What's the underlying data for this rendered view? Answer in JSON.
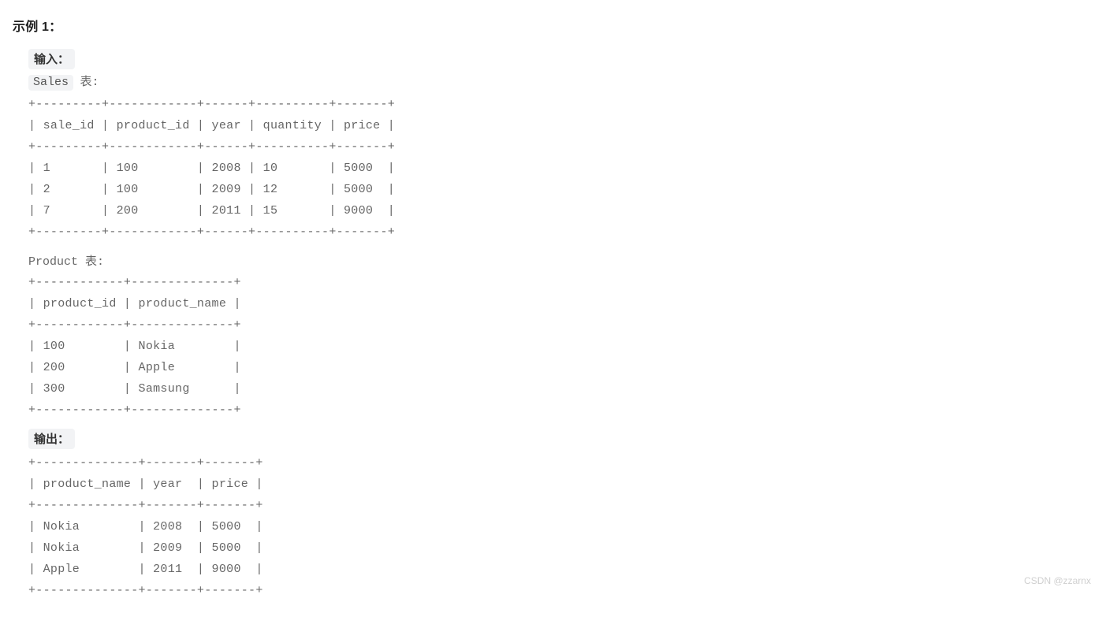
{
  "heading": "示例 1：",
  "input_label": "输入：",
  "tables": {
    "sales_line_prefix": "Sales",
    "sales_line_suffix": " 表:",
    "sales_ascii": "+---------+------------+------+----------+-------+\n| sale_id | product_id | year | quantity | price |\n+---------+------------+------+----------+-------+\n| 1       | 100        | 2008 | 10       | 5000  |\n| 2       | 100        | 2009 | 12       | 5000  |\n| 7       | 200        | 2011 | 15       | 9000  |\n+---------+------------+------+----------+-------+",
    "product_line": "Product 表:",
    "product_ascii": "+------------+--------------+\n| product_id | product_name |\n+------------+--------------+\n| 100        | Nokia        |\n| 200        | Apple        |\n| 300        | Samsung      |\n+------------+--------------+"
  },
  "output_label": "输出：",
  "output_ascii": "+--------------+-------+-------+\n| product_name | year  | price |\n+--------------+-------+-------+\n| Nokia        | 2008  | 5000  |\n| Nokia        | 2009  | 5000  |\n| Apple        | 2011  | 9000  |\n+--------------+-------+-------+",
  "watermark": "CSDN @zzarnx"
}
